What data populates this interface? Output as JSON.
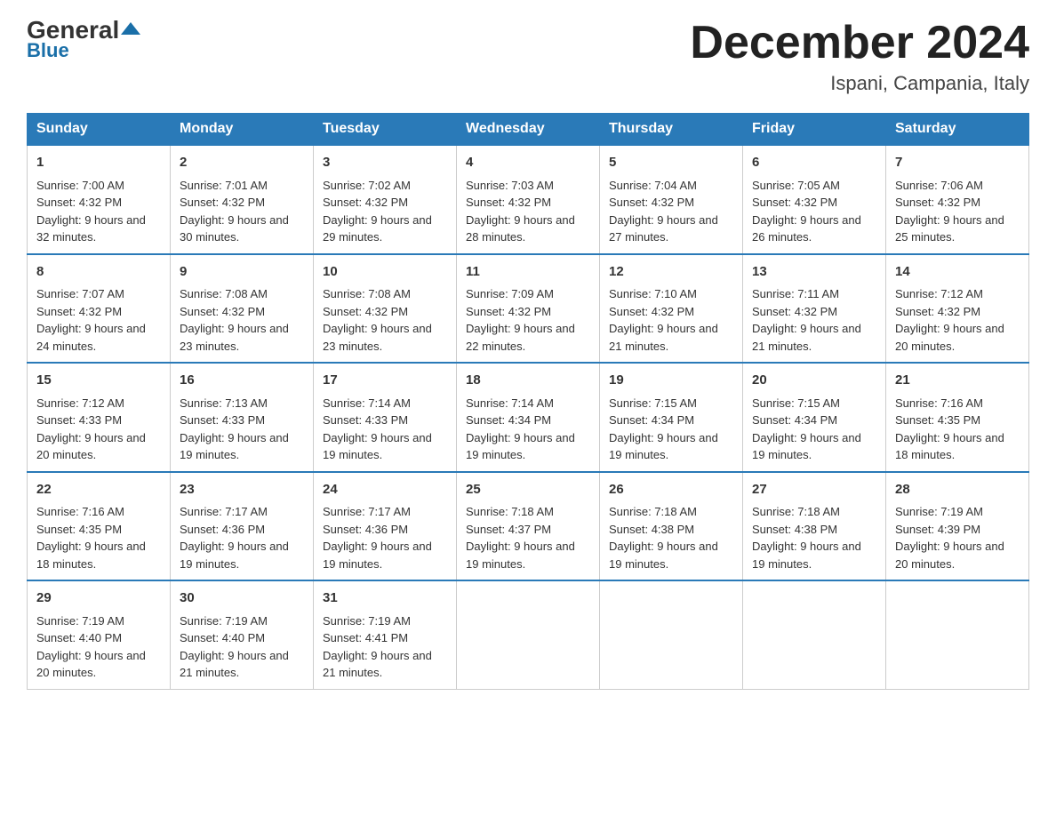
{
  "title": "December 2024",
  "subtitle": "Ispani, Campania, Italy",
  "logo": {
    "general": "General",
    "blue": "Blue"
  },
  "days": [
    "Sunday",
    "Monday",
    "Tuesday",
    "Wednesday",
    "Thursday",
    "Friday",
    "Saturday"
  ],
  "weeks": [
    [
      {
        "num": "1",
        "sunrise": "7:00 AM",
        "sunset": "4:32 PM",
        "daylight": "9 hours and 32 minutes."
      },
      {
        "num": "2",
        "sunrise": "7:01 AM",
        "sunset": "4:32 PM",
        "daylight": "9 hours and 30 minutes."
      },
      {
        "num": "3",
        "sunrise": "7:02 AM",
        "sunset": "4:32 PM",
        "daylight": "9 hours and 29 minutes."
      },
      {
        "num": "4",
        "sunrise": "7:03 AM",
        "sunset": "4:32 PM",
        "daylight": "9 hours and 28 minutes."
      },
      {
        "num": "5",
        "sunrise": "7:04 AM",
        "sunset": "4:32 PM",
        "daylight": "9 hours and 27 minutes."
      },
      {
        "num": "6",
        "sunrise": "7:05 AM",
        "sunset": "4:32 PM",
        "daylight": "9 hours and 26 minutes."
      },
      {
        "num": "7",
        "sunrise": "7:06 AM",
        "sunset": "4:32 PM",
        "daylight": "9 hours and 25 minutes."
      }
    ],
    [
      {
        "num": "8",
        "sunrise": "7:07 AM",
        "sunset": "4:32 PM",
        "daylight": "9 hours and 24 minutes."
      },
      {
        "num": "9",
        "sunrise": "7:08 AM",
        "sunset": "4:32 PM",
        "daylight": "9 hours and 23 minutes."
      },
      {
        "num": "10",
        "sunrise": "7:08 AM",
        "sunset": "4:32 PM",
        "daylight": "9 hours and 23 minutes."
      },
      {
        "num": "11",
        "sunrise": "7:09 AM",
        "sunset": "4:32 PM",
        "daylight": "9 hours and 22 minutes."
      },
      {
        "num": "12",
        "sunrise": "7:10 AM",
        "sunset": "4:32 PM",
        "daylight": "9 hours and 21 minutes."
      },
      {
        "num": "13",
        "sunrise": "7:11 AM",
        "sunset": "4:32 PM",
        "daylight": "9 hours and 21 minutes."
      },
      {
        "num": "14",
        "sunrise": "7:12 AM",
        "sunset": "4:32 PM",
        "daylight": "9 hours and 20 minutes."
      }
    ],
    [
      {
        "num": "15",
        "sunrise": "7:12 AM",
        "sunset": "4:33 PM",
        "daylight": "9 hours and 20 minutes."
      },
      {
        "num": "16",
        "sunrise": "7:13 AM",
        "sunset": "4:33 PM",
        "daylight": "9 hours and 19 minutes."
      },
      {
        "num": "17",
        "sunrise": "7:14 AM",
        "sunset": "4:33 PM",
        "daylight": "9 hours and 19 minutes."
      },
      {
        "num": "18",
        "sunrise": "7:14 AM",
        "sunset": "4:34 PM",
        "daylight": "9 hours and 19 minutes."
      },
      {
        "num": "19",
        "sunrise": "7:15 AM",
        "sunset": "4:34 PM",
        "daylight": "9 hours and 19 minutes."
      },
      {
        "num": "20",
        "sunrise": "7:15 AM",
        "sunset": "4:34 PM",
        "daylight": "9 hours and 19 minutes."
      },
      {
        "num": "21",
        "sunrise": "7:16 AM",
        "sunset": "4:35 PM",
        "daylight": "9 hours and 18 minutes."
      }
    ],
    [
      {
        "num": "22",
        "sunrise": "7:16 AM",
        "sunset": "4:35 PM",
        "daylight": "9 hours and 18 minutes."
      },
      {
        "num": "23",
        "sunrise": "7:17 AM",
        "sunset": "4:36 PM",
        "daylight": "9 hours and 19 minutes."
      },
      {
        "num": "24",
        "sunrise": "7:17 AM",
        "sunset": "4:36 PM",
        "daylight": "9 hours and 19 minutes."
      },
      {
        "num": "25",
        "sunrise": "7:18 AM",
        "sunset": "4:37 PM",
        "daylight": "9 hours and 19 minutes."
      },
      {
        "num": "26",
        "sunrise": "7:18 AM",
        "sunset": "4:38 PM",
        "daylight": "9 hours and 19 minutes."
      },
      {
        "num": "27",
        "sunrise": "7:18 AM",
        "sunset": "4:38 PM",
        "daylight": "9 hours and 19 minutes."
      },
      {
        "num": "28",
        "sunrise": "7:19 AM",
        "sunset": "4:39 PM",
        "daylight": "9 hours and 20 minutes."
      }
    ],
    [
      {
        "num": "29",
        "sunrise": "7:19 AM",
        "sunset": "4:40 PM",
        "daylight": "9 hours and 20 minutes."
      },
      {
        "num": "30",
        "sunrise": "7:19 AM",
        "sunset": "4:40 PM",
        "daylight": "9 hours and 21 minutes."
      },
      {
        "num": "31",
        "sunrise": "7:19 AM",
        "sunset": "4:41 PM",
        "daylight": "9 hours and 21 minutes."
      },
      null,
      null,
      null,
      null
    ]
  ]
}
